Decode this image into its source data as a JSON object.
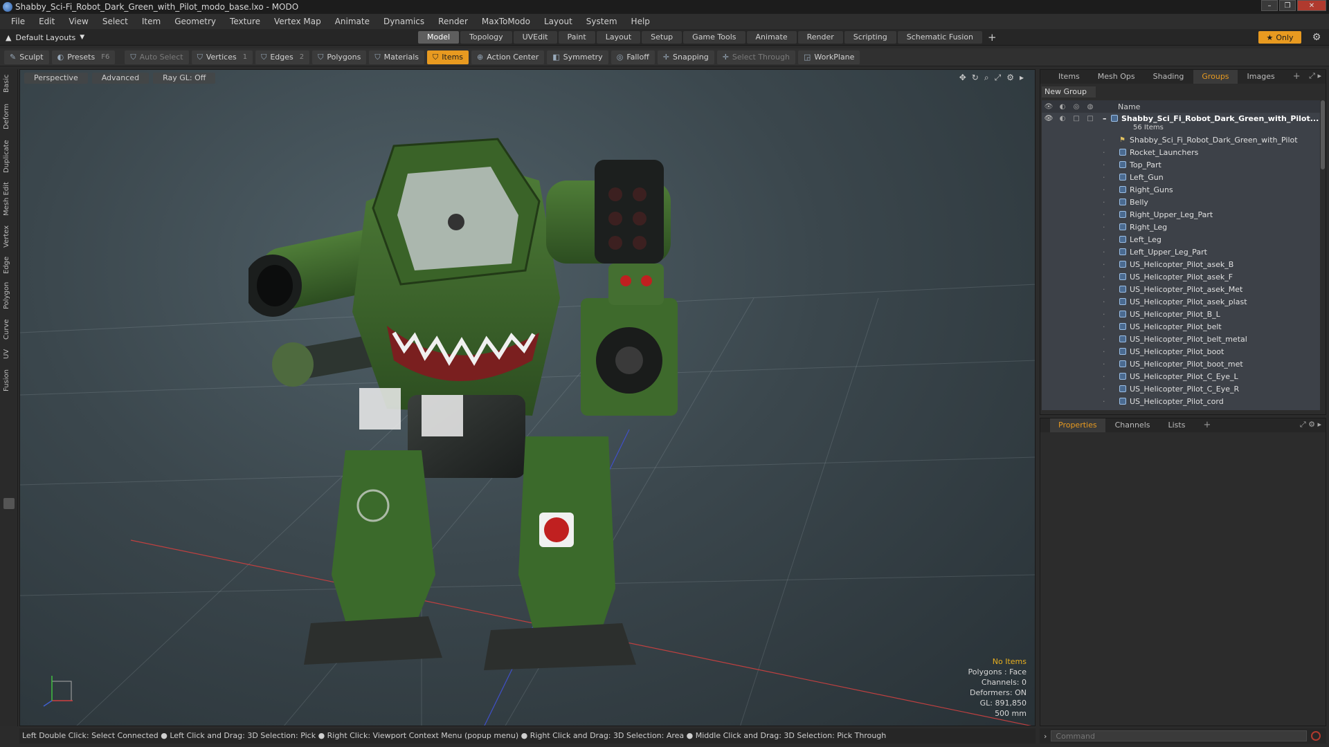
{
  "window": {
    "title": "Shabby_Sci-Fi_Robot_Dark_Green_with_Pilot_modo_base.lxo - MODO",
    "min": "–",
    "max": "❐",
    "close": "✕"
  },
  "menu": [
    "File",
    "Edit",
    "View",
    "Select",
    "Item",
    "Geometry",
    "Texture",
    "Vertex Map",
    "Animate",
    "Dynamics",
    "Render",
    "MaxToModo",
    "Layout",
    "System",
    "Help"
  ],
  "layoutbar": {
    "layout_dropdown": "Default Layouts",
    "tabs": [
      "Model",
      "Topology",
      "UVEdit",
      "Paint",
      "Layout",
      "Setup",
      "Game Tools",
      "Animate",
      "Render",
      "Scripting",
      "Schematic Fusion"
    ],
    "active_tab": "Model",
    "add": "+",
    "only_label": "Only"
  },
  "toolbar": {
    "sculpt": "Sculpt",
    "presets": "Presets",
    "presets_key": "F6",
    "auto_select": "Auto Select",
    "vertices": "Vertices",
    "vertices_count": "1",
    "edges": "Edges",
    "edges_count": "2",
    "polygons": "Polygons",
    "materials": "Materials",
    "items": "Items",
    "action_center": "Action Center",
    "symmetry": "Symmetry",
    "falloff": "Falloff",
    "snapping": "Snapping",
    "select_through": "Select Through",
    "workplane": "WorkPlane"
  },
  "left_tabs": [
    "Basic",
    "Deform",
    "Duplicate",
    "Mesh Edit",
    "Vertex",
    "Edge",
    "Polygon",
    "Curve",
    "UV",
    "Fusion"
  ],
  "viewport": {
    "perspective": "Perspective",
    "advanced": "Advanced",
    "raygl": "Ray GL: Off",
    "info": {
      "no_items": "No Items",
      "polygons": "Polygons : Face",
      "channels": "Channels: 0",
      "deformers": "Deformers: ON",
      "gl": "GL: 891,850",
      "scale": "500 mm"
    }
  },
  "status_bar": "Left Double Click: Select Connected ● Left Click and Drag: 3D Selection: Pick ● Right Click: Viewport Context Menu (popup menu) ● Right Click and Drag: 3D Selection: Area ● Middle Click and Drag: 3D Selection: Pick Through",
  "right_panel": {
    "tabs": [
      "Items",
      "Mesh Ops",
      "Shading",
      "Groups",
      "Images"
    ],
    "active_tab": "Groups",
    "add": "+",
    "new_group": "New Group",
    "col_name": "Name",
    "group_name": "Shabby_Sci_Fi_Robot_Dark_Green_with_Pilot...",
    "group_count": "56 Items",
    "items": [
      "Shabby_Sci_Fi_Robot_Dark_Green_with_Pilot",
      "Rocket_Launchers",
      "Top_Part",
      "Left_Gun",
      "Right_Guns",
      "Belly",
      "Right_Upper_Leg_Part",
      "Right_Leg",
      "Left_Leg",
      "Left_Upper_Leg_Part",
      "US_Helicopter_Pilot_asek_B",
      "US_Helicopter_Pilot_asek_F",
      "US_Helicopter_Pilot_asek_Met",
      "US_Helicopter_Pilot_asek_plast",
      "US_Helicopter_Pilot_B_L",
      "US_Helicopter_Pilot_belt",
      "US_Helicopter_Pilot_belt_metal",
      "US_Helicopter_Pilot_boot",
      "US_Helicopter_Pilot_boot_met",
      "US_Helicopter_Pilot_C_Eye_L",
      "US_Helicopter_Pilot_C_Eye_R",
      "US_Helicopter_Pilot_cord"
    ]
  },
  "props_panel": {
    "tabs": [
      "Properties",
      "Channels",
      "Lists"
    ],
    "active_tab": "Properties",
    "add": "+"
  },
  "command": {
    "placeholder": "Command"
  },
  "colors": {
    "accent": "#e89a20",
    "robot_green": "#3e6a2c",
    "panel": "#2c2c2c"
  }
}
